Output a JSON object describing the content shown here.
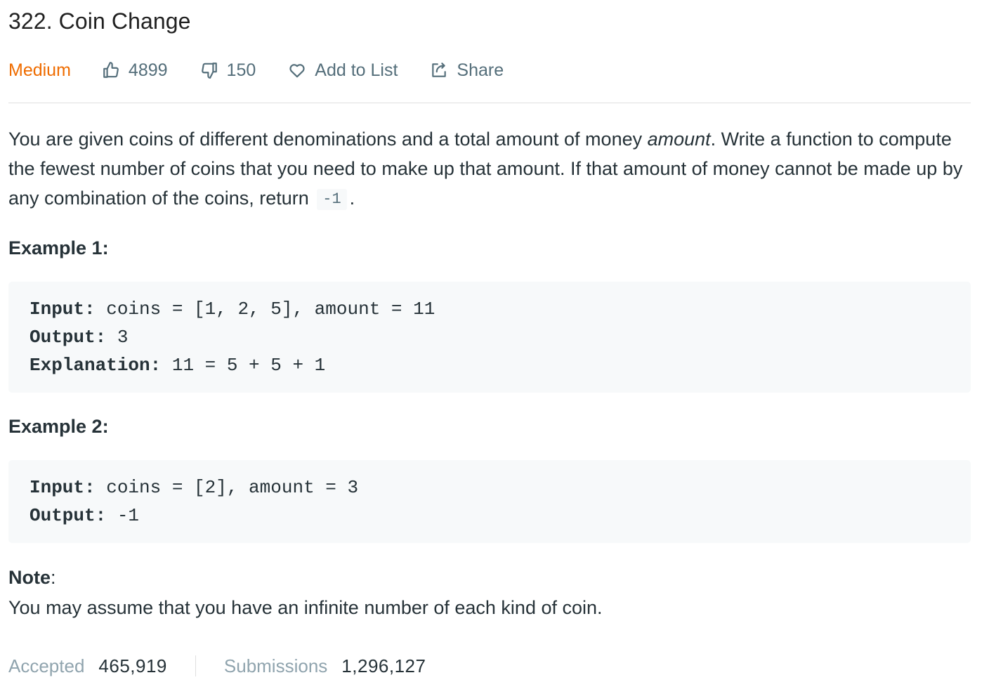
{
  "problem": {
    "title": "322. Coin Change",
    "difficulty": "Medium",
    "likes": "4899",
    "dislikes": "150",
    "add_to_list_label": "Add to List",
    "share_label": "Share"
  },
  "description": {
    "part1": "You are given coins of different denominations and a total amount of money ",
    "italic": "amount",
    "part2": ". Write a function to compute the fewest number of coins that you need to make up that amount. If that amount of money cannot be made up by any combination of the coins, return ",
    "code": "-1",
    "part3": "."
  },
  "examples": [
    {
      "heading": "Example 1:",
      "lines": [
        {
          "key": "Input:",
          "value": " coins = [1, 2, 5], amount = 11"
        },
        {
          "key": "Output:",
          "value": " 3"
        },
        {
          "key": "Explanation:",
          "value": " 11 = 5 + 5 + 1"
        }
      ]
    },
    {
      "heading": "Example 2:",
      "lines": [
        {
          "key": "Input:",
          "value": " coins = [2], amount = 3"
        },
        {
          "key": "Output:",
          "value": " -1"
        }
      ]
    }
  ],
  "note": {
    "heading": "Note",
    "colon": ":",
    "text": "You may assume that you have an infinite number of each kind of coin."
  },
  "stats": {
    "accepted_label": "Accepted",
    "accepted_value": "465,919",
    "submissions_label": "Submissions",
    "submissions_value": "1,296,127"
  },
  "colors": {
    "difficulty_medium": "#ef6c00",
    "muted_text": "#546e7a",
    "code_bg": "#f7f9fa"
  },
  "icons": {
    "like": "thumbs-up-icon",
    "dislike": "thumbs-down-icon",
    "add_to_list": "heart-icon",
    "share": "share-icon"
  }
}
